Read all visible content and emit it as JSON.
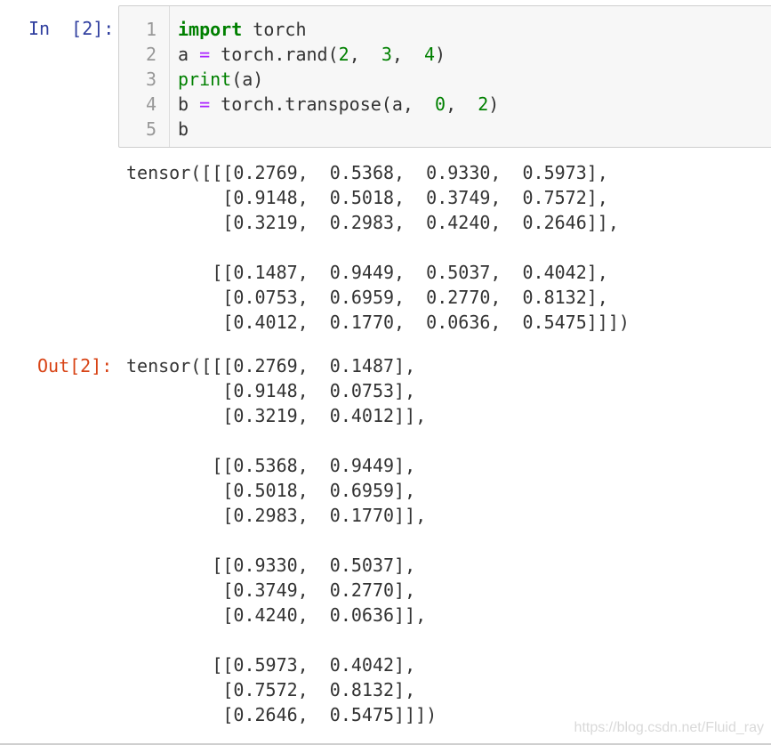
{
  "cell": {
    "in_prompt": "In  [2]:",
    "out_prompt": "Out[2]:",
    "code": {
      "line_numbers": [
        "1",
        "2",
        "3",
        "4",
        "5"
      ],
      "lines": [
        [
          {
            "t": "import",
            "c": "kw"
          },
          {
            "t": " torch",
            "c": ""
          }
        ],
        [
          {
            "t": "a ",
            "c": ""
          },
          {
            "t": "=",
            "c": "op"
          },
          {
            "t": " torch.rand(",
            "c": ""
          },
          {
            "t": "2",
            "c": "num"
          },
          {
            "t": ",  ",
            "c": ""
          },
          {
            "t": "3",
            "c": "num"
          },
          {
            "t": ",  ",
            "c": ""
          },
          {
            "t": "4",
            "c": "num"
          },
          {
            "t": ")",
            "c": ""
          }
        ],
        [
          {
            "t": "print",
            "c": "bi"
          },
          {
            "t": "(a)",
            "c": ""
          }
        ],
        [
          {
            "t": "b ",
            "c": ""
          },
          {
            "t": "=",
            "c": "op"
          },
          {
            "t": " torch.transpose(a,  ",
            "c": ""
          },
          {
            "t": "0",
            "c": "num"
          },
          {
            "t": ",  ",
            "c": ""
          },
          {
            "t": "2",
            "c": "num"
          },
          {
            "t": ")",
            "c": ""
          }
        ],
        [
          {
            "t": "b",
            "c": ""
          }
        ]
      ]
    },
    "stdout": "tensor([[[0.2769,  0.5368,  0.9330,  0.5973],\n         [0.9148,  0.5018,  0.3749,  0.7572],\n         [0.3219,  0.2983,  0.4240,  0.2646]],\n\n        [[0.1487,  0.9449,  0.5037,  0.4042],\n         [0.0753,  0.6959,  0.2770,  0.8132],\n         [0.4012,  0.1770,  0.0636,  0.5475]]])",
    "result": "tensor([[[0.2769,  0.1487],\n         [0.9148,  0.0753],\n         [0.3219,  0.4012]],\n\n        [[0.5368,  0.9449],\n         [0.5018,  0.6959],\n         [0.2983,  0.1770]],\n\n        [[0.9330,  0.5037],\n         [0.3749,  0.2770],\n         [0.4240,  0.0636]],\n\n        [[0.5973,  0.4042],\n         [0.7572,  0.8132],\n         [0.2646,  0.5475]]])"
  },
  "watermark": "https://blog.csdn.net/Fluid_ray"
}
